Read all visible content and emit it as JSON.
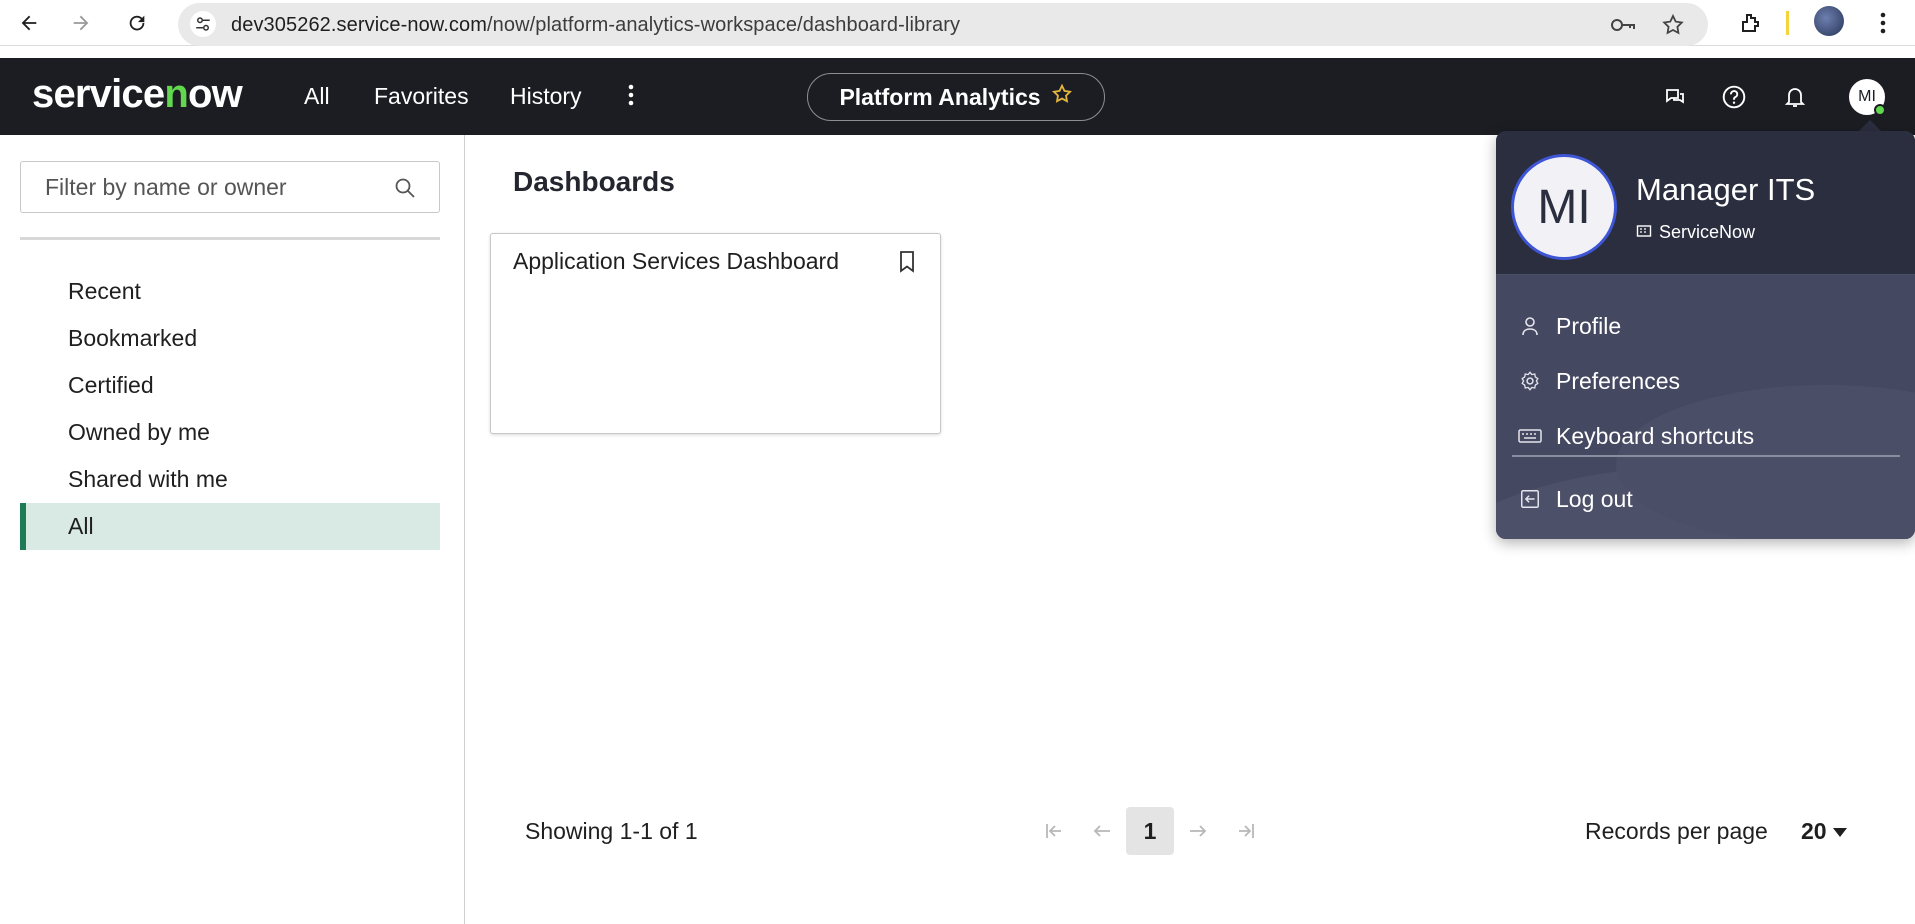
{
  "browser": {
    "url_host": "dev305262.service-now.com",
    "url_path": "/now/platform-analytics-workspace/dashboard-library"
  },
  "topnav": {
    "logo": "servicenow",
    "menu_all": "All",
    "menu_favorites": "Favorites",
    "menu_history": "History",
    "app_name": "Platform Analytics",
    "avatar_initials": "MI"
  },
  "sidebar": {
    "filter_placeholder": "Filter by name or owner",
    "items": [
      {
        "label": "Recent"
      },
      {
        "label": "Bookmarked"
      },
      {
        "label": "Certified"
      },
      {
        "label": "Owned by me"
      },
      {
        "label": "Shared with me"
      },
      {
        "label": "All"
      }
    ]
  },
  "main": {
    "title": "Dashboards",
    "cards": [
      {
        "title": "Application Services Dashboard"
      }
    ]
  },
  "pagination": {
    "status": "Showing 1-1 of 1",
    "current_page": "1",
    "records_per_page_label": "Records per page",
    "records_per_page_value": "20"
  },
  "user_menu": {
    "initials": "MI",
    "name": "Manager ITS",
    "company": "ServiceNow",
    "items": [
      {
        "label": "Profile",
        "icon": "user-icon"
      },
      {
        "label": "Preferences",
        "icon": "gear-icon"
      },
      {
        "label": "Keyboard shortcuts",
        "icon": "keyboard-icon"
      },
      {
        "label": "Log out",
        "icon": "logout-icon"
      }
    ]
  },
  "colors": {
    "nav_bg": "#1b1d22",
    "logo_accent": "#62d84e",
    "active_item_bg": "#d9e9e4",
    "active_item_bar": "#1f7a56",
    "menu_bg": "#2b2e3f",
    "avatar_ring": "#3e56d6"
  }
}
